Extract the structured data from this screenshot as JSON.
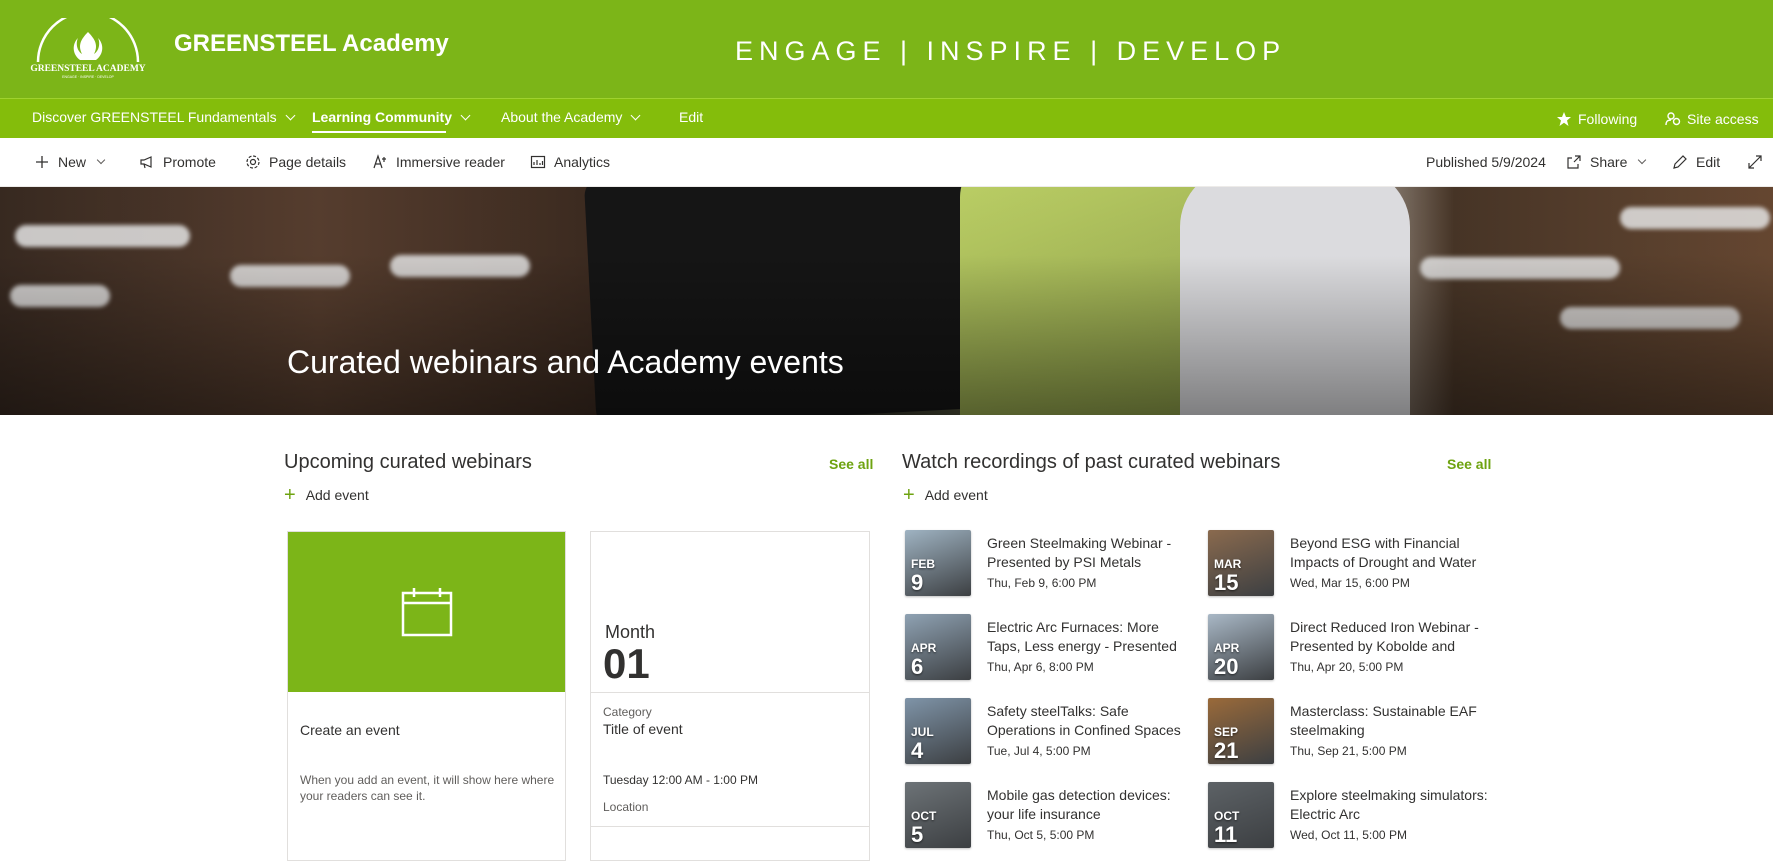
{
  "site": {
    "title": "GREENSTEEL Academy",
    "tagline": "ENGAGE | INSPIRE | DEVELOP",
    "logo_text": "GREENSTEEL ACADEMY",
    "logo_subtext": "ENGAGE · INSPIRE · DEVELOP"
  },
  "topnav": {
    "items": [
      {
        "label": "Discover GREENSTEEL Fundamentals",
        "has_menu": true
      },
      {
        "label": "Learning Community",
        "has_menu": true,
        "active": true
      },
      {
        "label": "About the Academy",
        "has_menu": true
      },
      {
        "label": "Edit",
        "has_menu": false
      }
    ],
    "following_label": "Following",
    "site_access_label": "Site access"
  },
  "cmdbar": {
    "new_label": "New",
    "promote_label": "Promote",
    "page_details_label": "Page details",
    "immersive_reader_label": "Immersive reader",
    "analytics_label": "Analytics",
    "published_label": "Published 5/9/2024",
    "share_label": "Share",
    "edit_label": "Edit"
  },
  "hero": {
    "title": "Curated webinars and Academy events"
  },
  "upcoming": {
    "title": "Upcoming curated webinars",
    "see_all": "See all",
    "add_event": "Add event",
    "create_card": {
      "title": "Create an event",
      "description": "When you add an event, it will show here where your readers can see it."
    },
    "sample_card": {
      "month": "Month",
      "day": "01",
      "category_label": "Category",
      "title": "Title of event",
      "time": "Tuesday 12:00 AM - 1:00 PM",
      "location": "Location"
    }
  },
  "recordings": {
    "title": "Watch recordings of past curated webinars",
    "see_all": "See all",
    "add_event": "Add event",
    "items": [
      {
        "mon": "FEB",
        "day": "9",
        "title": "Green Steelmaking Webinar - Presented by PSI Metals",
        "date": "Thu, Feb 9, 6:00 PM",
        "color": "#9fb3c2"
      },
      {
        "mon": "MAR",
        "day": "15",
        "title": "Beyond ESG with Financial Impacts of Drought and Water",
        "date": "Wed, Mar 15, 6:00 PM",
        "color": "#8a6a4e"
      },
      {
        "mon": "APR",
        "day": "6",
        "title": "Electric Arc Furnaces: More Taps, Less energy - Presented",
        "date": "Thu, Apr 6, 8:00 PM",
        "color": "#8fa2b3"
      },
      {
        "mon": "APR",
        "day": "20",
        "title": "Direct Reduced Iron Webinar - Presented by Kobolde and",
        "date": "Thu, Apr 20, 5:00 PM",
        "color": "#a9b8c6"
      },
      {
        "mon": "JUL",
        "day": "4",
        "title": "Safety steelTalks: Safe Operations in Confined Spaces",
        "date": "Tue, Jul 4, 5:00 PM",
        "color": "#7f94a8"
      },
      {
        "mon": "SEP",
        "day": "21",
        "title": "Masterclass: Sustainable EAF steelmaking",
        "date": "Thu, Sep 21, 5:00 PM",
        "color": "#9a6a3a"
      },
      {
        "mon": "OCT",
        "day": "5",
        "title": "Mobile gas detection devices: your life insurance",
        "date": "Thu, Oct 5, 5:00 PM",
        "color": "#6d7377"
      },
      {
        "mon": "OCT",
        "day": "11",
        "title": "Explore steelmaking simulators: Electric Arc",
        "date": "Wed, Oct 11, 5:00 PM",
        "color": "#5d6266"
      }
    ]
  },
  "colors": {
    "brand": "#7cb518",
    "nav": "#84bd0b",
    "accent_text": "#6ea310"
  },
  "icons": [
    "calendar-icon",
    "star-icon",
    "people-icon",
    "plus-icon",
    "megaphone-icon",
    "gear-icon",
    "reader-icon",
    "analytics-icon",
    "share-icon",
    "pencil-icon",
    "expand-icon"
  ]
}
